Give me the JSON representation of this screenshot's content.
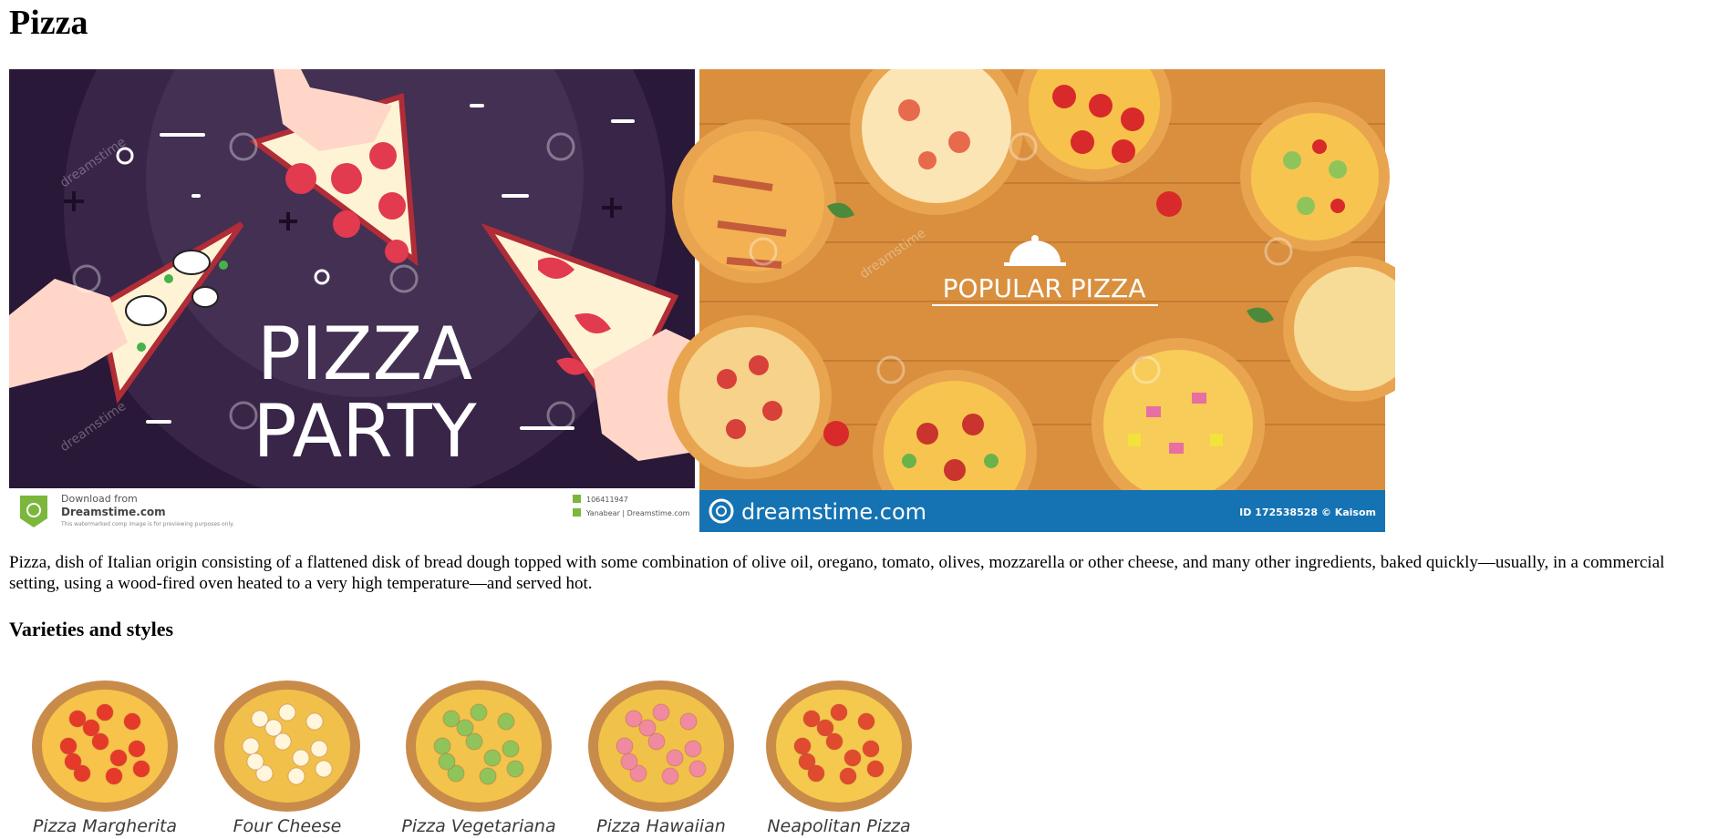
{
  "page": {
    "title": "Pizza",
    "description": "Pizza, dish of Italian origin consisting of a flattened disk of bread dough topped with some combination of olive oil, oregano, tomato, olives, mozzarella or other cheese, and many other ingredients, baked quickly—usually, in a commercial setting, using a wood-fired oven heated to a very high temperature—and served hot.",
    "section_heading": "Varieties and styles"
  },
  "hero_left": {
    "headline_line1": "PIZZA",
    "headline_line2": "PARTY",
    "watermark": "dreamstime",
    "footer_download": "Download from",
    "footer_brand": "Dreamstime.com",
    "footer_note": "This watermarked comp image is for previewing purposes only.",
    "footer_id": "106411947",
    "footer_author": "Yanabear | Dreamstime.com",
    "colors": {
      "background": "#2a1838",
      "accent": "#e23a4f"
    }
  },
  "hero_right": {
    "headline": "POPULAR PIZZA",
    "brand": "dreamstime.com",
    "image_id": "ID 172538528 © Kaisom",
    "watermark": "dreamstime",
    "colors": {
      "wood": "#d98f3e",
      "banner": "#1573b3"
    }
  },
  "varieties": [
    {
      "label": "Pizza Margherita",
      "topping": "#e53a2a",
      "cheese": "#f7c34a"
    },
    {
      "label": "Four Cheese",
      "topping": "#fff6dc",
      "cheese": "#f1c04a"
    },
    {
      "label": "Pizza Vegetariana",
      "topping": "#8fc45a",
      "cheese": "#f3c44b"
    },
    {
      "label": "Pizza Hawaiian",
      "topping": "#f08aa0",
      "cheese": "#f1c24a"
    },
    {
      "label": "Neapolitan Pizza",
      "topping": "#e04a2e",
      "cheese": "#f4c94d"
    }
  ]
}
